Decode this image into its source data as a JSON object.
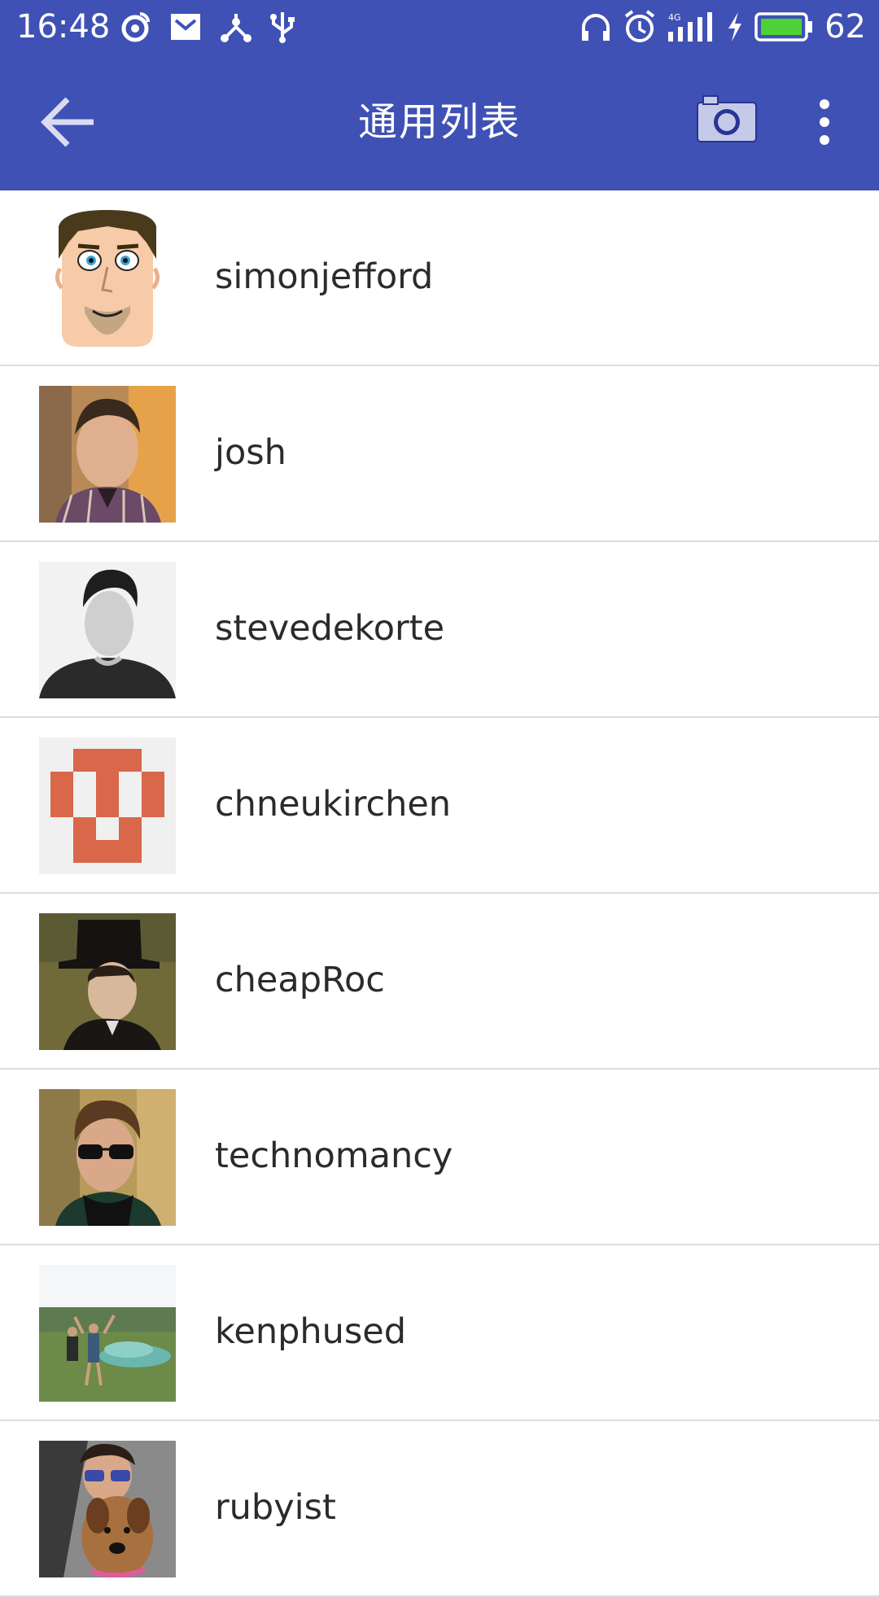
{
  "status_bar": {
    "time": "16:48",
    "battery_level": "62",
    "left_icons": [
      "weibo-icon",
      "mail-icon",
      "share-nodes-icon",
      "usb-icon"
    ],
    "right_icons": [
      "headphones-icon",
      "alarm-icon",
      "signal-4g-icon",
      "charging-icon",
      "battery-icon"
    ]
  },
  "app_bar": {
    "title": "通用列表",
    "color": "#3F51B5"
  },
  "list": {
    "items": [
      {
        "name": "simonjefford",
        "avatar": "cartoon-face-avatar"
      },
      {
        "name": "josh",
        "avatar": "photo-avatar"
      },
      {
        "name": "stevedekorte",
        "avatar": "photo-avatar"
      },
      {
        "name": "chneukirchen",
        "avatar": "identicon-avatar"
      },
      {
        "name": "cheapRoc",
        "avatar": "painting-avatar"
      },
      {
        "name": "technomancy",
        "avatar": "photo-avatar"
      },
      {
        "name": "kenphused",
        "avatar": "photo-avatar"
      },
      {
        "name": "rubyist",
        "avatar": "photo-avatar"
      }
    ]
  }
}
